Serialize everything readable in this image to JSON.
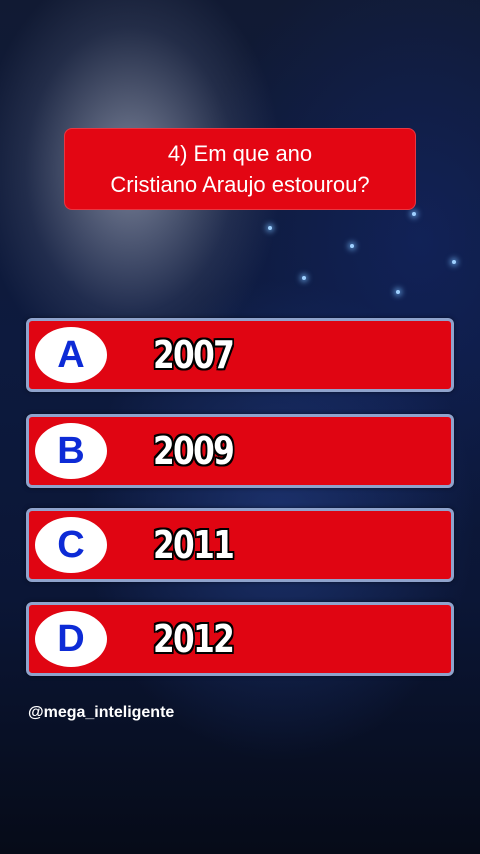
{
  "quiz": {
    "question_line1": "4) Em que ano",
    "question_line2": "Cristiano Araujo estourou?",
    "answers": [
      {
        "letter": "A",
        "text": "2007"
      },
      {
        "letter": "B",
        "text": "2009"
      },
      {
        "letter": "C",
        "text": "2011"
      },
      {
        "letter": "D",
        "text": "2012"
      }
    ]
  },
  "footer": {
    "handle": "@mega_inteligente"
  },
  "colors": {
    "accent_red": "#e30613",
    "letter_blue": "#0d2bd6",
    "answer_border": "#8fa3cc"
  }
}
